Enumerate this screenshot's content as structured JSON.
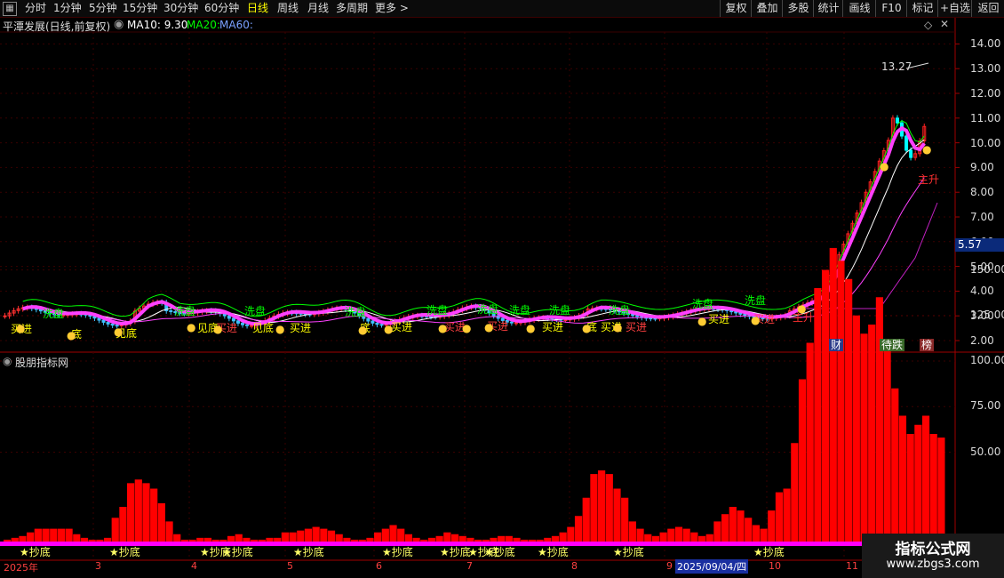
{
  "toolbar": {
    "periods": [
      "分时",
      "1分钟",
      "5分钟",
      "15分钟",
      "30分钟",
      "60分钟",
      "日线",
      "周线",
      "月线",
      "多周期",
      "更多 >"
    ],
    "active_index": 6,
    "right_buttons": [
      "复权",
      "叠加",
      "多股",
      "统计",
      "画线",
      "F10",
      "标记",
      "+自选",
      "返回"
    ]
  },
  "header": {
    "title": "平潭发展(日线,前复权)",
    "ma10": "MA10: 9.30",
    "ma20": "MA20:",
    "ma60": "MA60:"
  },
  "price_axis": [
    "14.00",
    "13.00",
    "12.00",
    "11.00",
    "10.00",
    "9.00",
    "8.00",
    "7.00",
    "6.00",
    "5.00",
    "4.00",
    "3.00",
    "2.00"
  ],
  "current_price": "5.57",
  "high_marker": "13.27",
  "signal_labels": {
    "wash": "洗盘",
    "buy": "买进",
    "bottom": "见底",
    "rise": "主升",
    "bottom2": "底"
  },
  "badges": {
    "cai": "财",
    "dai": "待跌",
    "sheng": "榜"
  },
  "indicator": {
    "title": "股朋指标网",
    "axis": [
      "150.00",
      "125.00",
      "100.00",
      "75.00",
      "50.00"
    ],
    "signal": "抄底"
  },
  "date_axis": {
    "labels": [
      "2025年",
      "3",
      "4",
      "5",
      "6",
      "7",
      "8",
      "9",
      "10",
      "11"
    ],
    "cursor_date": "2025/09/04/四"
  },
  "watermark": {
    "title": "指标公式网",
    "url": "www.zbgs3.com"
  },
  "chart_data": {
    "type": "bar",
    "title": "股朋指标网",
    "ylim": [
      0,
      170
    ],
    "x": [
      "2025年",
      "3",
      "4",
      "5",
      "6",
      "7",
      "8",
      "9",
      "10",
      "11"
    ],
    "values": [
      2,
      3,
      4,
      6,
      8,
      8,
      8,
      8,
      8,
      5,
      3,
      2,
      2,
      3,
      14,
      20,
      33,
      35,
      33,
      30,
      22,
      12,
      5,
      2,
      2,
      3,
      3,
      2,
      2,
      4,
      5,
      3,
      2,
      2,
      3,
      3,
      6,
      6,
      7,
      8,
      9,
      8,
      7,
      5,
      3,
      2,
      2,
      3,
      6,
      8,
      10,
      8,
      5,
      3,
      2,
      3,
      4,
      6,
      5,
      4,
      3,
      2,
      2,
      3,
      4,
      4,
      3,
      2,
      2,
      2,
      3,
      4,
      6,
      9,
      15,
      25,
      38,
      40,
      38,
      30,
      25,
      12,
      8,
      5,
      4,
      6,
      8,
      9,
      8,
      6,
      4,
      5,
      12,
      16,
      20,
      18,
      14,
      10,
      8,
      18,
      28,
      30,
      55,
      90,
      110,
      140,
      150,
      162,
      155,
      145,
      125,
      115,
      120,
      135,
      110,
      85,
      70,
      60,
      65,
      70,
      60,
      58
    ]
  }
}
